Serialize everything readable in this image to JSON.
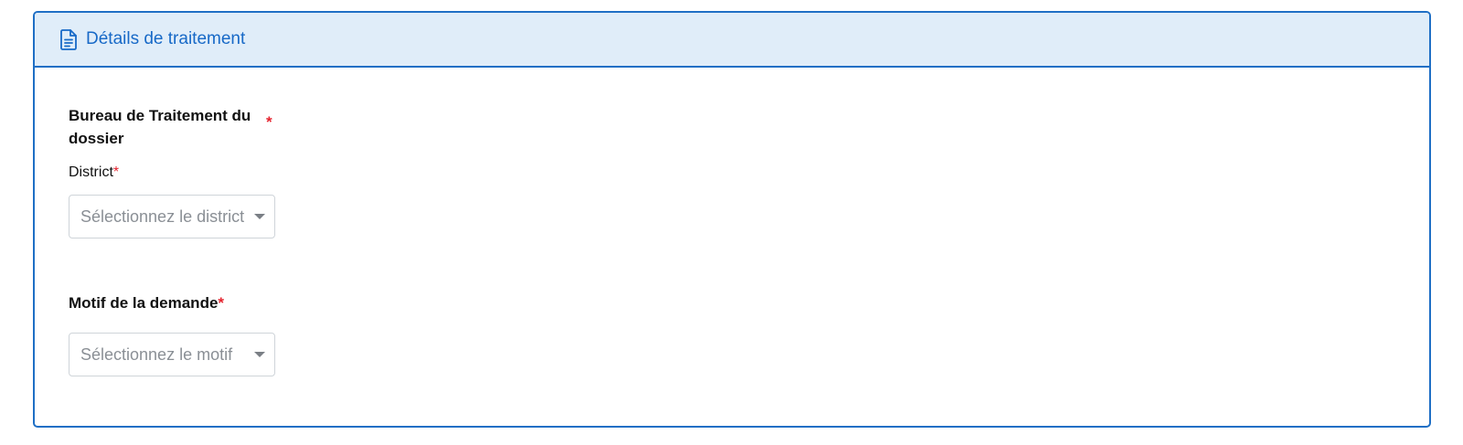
{
  "panel": {
    "title": "Détails de traitement",
    "icon": "document-icon",
    "accent_color": "#1f6fc5",
    "header_bg": "#e0edf9"
  },
  "bureau": {
    "label": "Bureau de Traitement du dossier",
    "required_mark": "*"
  },
  "district": {
    "label": "District",
    "required_mark": "*",
    "placeholder": "Sélectionnez le district"
  },
  "motif": {
    "label": "Motif de la demande",
    "required_mark": "*",
    "placeholder": "Sélectionnez le motif"
  },
  "required_color": "#e5232e"
}
